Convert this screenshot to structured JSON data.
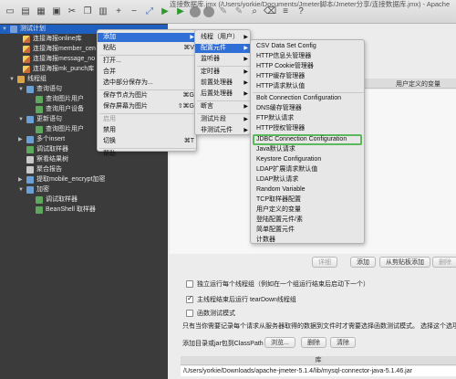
{
  "window": {
    "title": "连接数据库.jmx (/Users/yorkie/Documents/Jmeter脚本/Jmeter分享/连接数据库.jmx) - Apache"
  },
  "tree": {
    "items": [
      {
        "label": "测试计划",
        "icon": "test-plan-icon",
        "toggle": "▼",
        "selected": true
      },
      {
        "label": "连接海报online库",
        "icon": "pencil-icon"
      },
      {
        "label": "连接海报member_cen",
        "icon": "pencil-icon"
      },
      {
        "label": "连接海报message_no",
        "icon": "pencil-icon"
      },
      {
        "label": "连接海报mk_punch库",
        "icon": "pencil-icon"
      },
      {
        "label": "线程组",
        "icon": "thread-group-icon",
        "toggle": "▼"
      },
      {
        "label": "查询语句",
        "icon": "controller-icon",
        "toggle": "▼"
      },
      {
        "label": "查询图片用户",
        "icon": "sampler-icon"
      },
      {
        "label": "查询用户设备",
        "icon": "sampler-icon"
      },
      {
        "label": "更新语句",
        "icon": "controller-icon",
        "toggle": "▼"
      },
      {
        "label": "查询图片用户",
        "icon": "sampler-icon"
      },
      {
        "label": "多个insert",
        "icon": "controller-icon",
        "toggle": "▶"
      },
      {
        "label": "调试取样器",
        "icon": "sampler-icon"
      },
      {
        "label": "察看结果树",
        "icon": "listener-icon"
      },
      {
        "label": "聚合报告",
        "icon": "listener-icon"
      },
      {
        "label": "提取mobile_encrypt加密",
        "icon": "controller-icon",
        "toggle": "▶"
      },
      {
        "label": "加密",
        "icon": "controller-icon",
        "toggle": "▼"
      },
      {
        "label": "调试取样器",
        "icon": "sampler-icon"
      },
      {
        "label": "BeanShell 取样器",
        "icon": "sampler-icon"
      }
    ]
  },
  "context_menu": {
    "items": [
      {
        "label": "添加",
        "submenu": true,
        "active": true
      },
      {
        "label": "粘贴",
        "shortcut": "⌘V"
      },
      {
        "label": "打开..."
      },
      {
        "label": "合并"
      },
      {
        "label": "选中部分保存为..."
      },
      {
        "label": "保存节点为图片",
        "shortcut": "⌘G"
      },
      {
        "label": "保存屏幕为图片",
        "shortcut": "⇧⌘G"
      },
      {
        "label": "启用",
        "dim": true
      },
      {
        "label": "禁用"
      },
      {
        "label": "切换",
        "shortcut": "⌘T"
      },
      {
        "label": "帮助"
      }
    ]
  },
  "add_menu": {
    "items": [
      {
        "label": "线程（用户）",
        "submenu": true
      },
      {
        "label": "配置元件",
        "submenu": true,
        "active": true
      },
      {
        "label": "监听器",
        "submenu": true
      },
      {
        "label": "定时器",
        "submenu": true
      },
      {
        "label": "前置处理器",
        "submenu": true
      },
      {
        "label": "后置处理器",
        "submenu": true
      },
      {
        "label": "断言",
        "submenu": true
      },
      {
        "label": "测试片段",
        "submenu": true
      },
      {
        "label": "非测试元件",
        "submenu": true
      }
    ]
  },
  "config_menu": {
    "items": [
      {
        "label": "CSV Data Set Config"
      },
      {
        "label": "HTTP信息头管理器"
      },
      {
        "label": "HTTP Cookie管理器"
      },
      {
        "label": "HTTP缓存管理器"
      },
      {
        "label": "HTTP请求默认值"
      },
      {
        "label": "Bolt Connection Configuration"
      },
      {
        "label": "DNS缓存管理器"
      },
      {
        "label": "FTP默认请求"
      },
      {
        "label": "HTTP授权管理器"
      },
      {
        "label": "JDBC Connection Configuration",
        "highlight": true
      },
      {
        "label": "Java默认请求"
      },
      {
        "label": "Keystore Configuration"
      },
      {
        "label": "LDAP扩展请求默认值"
      },
      {
        "label": "LDAP默认请求"
      },
      {
        "label": "Random Variable"
      },
      {
        "label": "TCP取样器配置"
      },
      {
        "label": "用户定义的变量"
      },
      {
        "label": "登陆配置元件/素"
      },
      {
        "label": "简单配置元件"
      },
      {
        "label": "计数器"
      }
    ]
  },
  "main": {
    "vars_header": "用户定义的变量",
    "buttons": {
      "detail": "详细",
      "add": "添加",
      "add_clipboard": "从剪贴板添加",
      "delete": "删除"
    },
    "options": [
      {
        "label": "独立运行每个线程组（例如在一个组运行结束后启动下一个）",
        "checked": false
      },
      {
        "label": "主线程结束后运行 tearDown线程组",
        "checked": true
      },
      {
        "label": "函数测试模式",
        "checked": false
      }
    ],
    "help_text": "只有当你需要记录每个请求从服务器取得的数据到文件时才需要选择函数测试模式。 选择这个选项很",
    "classpath_label": "添加目录或jar包到ClassPath",
    "classpath_buttons": {
      "browse": "浏览...",
      "delete": "删除",
      "clear": "清除"
    },
    "lib_header": "库",
    "lib_rows": [
      "/Users/yorkie/Downloads/apache-jmeter-5.1.4/lib/mysql-connector-java-5.1.46.jar"
    ]
  }
}
